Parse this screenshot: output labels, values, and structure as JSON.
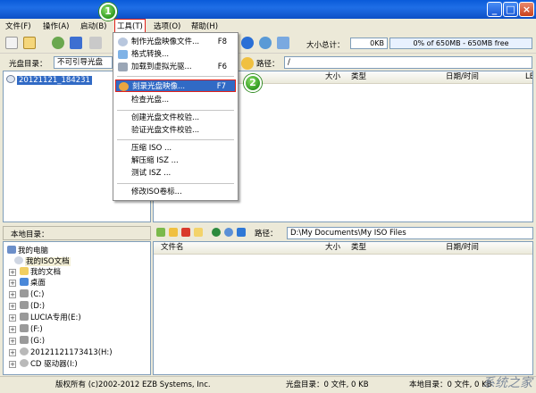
{
  "menubar": {
    "items": [
      "文件(F)",
      "操作(A)",
      "启动(B)",
      "工具(T)",
      "选项(O)",
      "帮助(H)"
    ]
  },
  "toolbar": {
    "total_size_label": "大小总计：",
    "total_size_value": "0KB",
    "capacity_text": "0% of 650MB - 650MB free"
  },
  "disc_bar": {
    "label": "光盘目录：",
    "boot_value": "不可引导光盘",
    "path_label": "路径：",
    "path_value": "/"
  },
  "disc_tree": {
    "root": "20121121_184231"
  },
  "disc_columns": [
    "大小",
    "类型",
    "日期/时间",
    "LE"
  ],
  "tools_menu": {
    "items": [
      {
        "label": "制作光盘映像文件...",
        "shortcut": "F8"
      },
      {
        "label": "格式转换...",
        "shortcut": ""
      },
      {
        "label": "加载到虚拟光驱...",
        "shortcut": "F6"
      },
      {
        "label": "刻录光盘映像...",
        "shortcut": "F7"
      },
      {
        "label": "检查光盘...",
        "shortcut": ""
      },
      {
        "label": "创建光盘文件校验...",
        "shortcut": ""
      },
      {
        "label": "验证光盘文件校验...",
        "shortcut": ""
      },
      {
        "label": "压缩 ISO ...",
        "shortcut": ""
      },
      {
        "label": "解压缩 ISZ ...",
        "shortcut": ""
      },
      {
        "label": "测试 ISZ ...",
        "shortcut": ""
      },
      {
        "label": "修改ISO卷标...",
        "shortcut": ""
      }
    ]
  },
  "step_badges": [
    "1",
    "2"
  ],
  "local_bar": {
    "label": "本地目录：",
    "path_label": "路径：",
    "path_value": "D:\\My Documents\\My ISO Files"
  },
  "local_tree": [
    "我的电脑",
    "我的ISO文档",
    "我的文档",
    "桌面",
    "(C:)",
    "(D:)",
    "LUCIA专用(E:)",
    "(F:)",
    "(G:)",
    "20121121173413(H:)",
    "CD 驱动器(I:)"
  ],
  "local_columns": [
    "文件名",
    "大小",
    "类型",
    "日期/时间"
  ],
  "status": {
    "copyright": "版权所有 (c)2002-2012 EZB Systems, Inc.",
    "disc_dir": "光盘目录：0 文件, 0 KB",
    "local_dir": "本地目录：0 文件, 0 KB"
  },
  "watermark": "系统之家",
  "colors": {
    "highlight": "#316ac5",
    "step_badge": "#2f9a20",
    "callout_border": "#e0201a"
  }
}
